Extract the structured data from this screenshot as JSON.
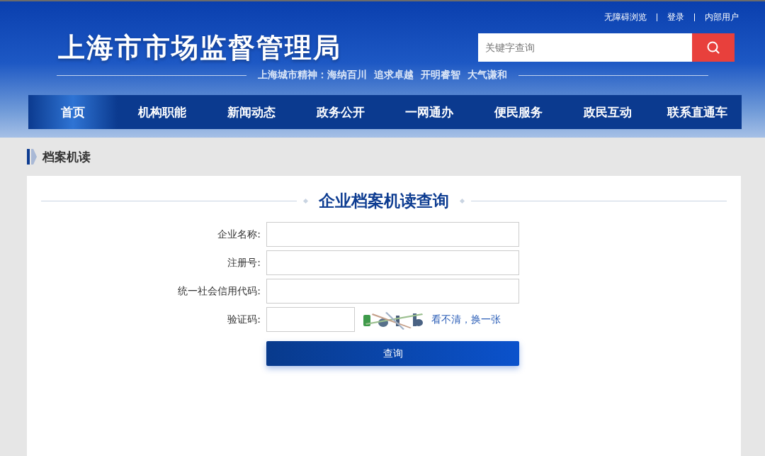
{
  "top_links": [
    "无障碍浏览",
    "登录",
    "内部用户"
  ],
  "site_title": "上海市市场监督管理局",
  "search": {
    "placeholder": "关键字查询"
  },
  "motto": "上海城市精神：海纳百川  追求卓越  开明睿智  大气谦和",
  "nav": [
    {
      "label": "首页",
      "selected": true
    },
    {
      "label": "机构职能",
      "selected": false
    },
    {
      "label": "新闻动态",
      "selected": false
    },
    {
      "label": "政务公开",
      "selected": false
    },
    {
      "label": "一网通办",
      "selected": false
    },
    {
      "label": "便民服务",
      "selected": false
    },
    {
      "label": "政民互动",
      "selected": false
    },
    {
      "label": "联系直通车",
      "selected": false
    }
  ],
  "breadcrumb": "档案机读",
  "form": {
    "title": "企业档案机读查询",
    "fields": [
      {
        "label": "企业名称:",
        "kind": "text"
      },
      {
        "label": "注册号:",
        "kind": "text"
      },
      {
        "label": "统一社会信用代码:",
        "kind": "text"
      },
      {
        "label": "验证码:",
        "kind": "captcha",
        "refresh_link": "看不清，换一张"
      }
    ],
    "submit": "查询"
  }
}
